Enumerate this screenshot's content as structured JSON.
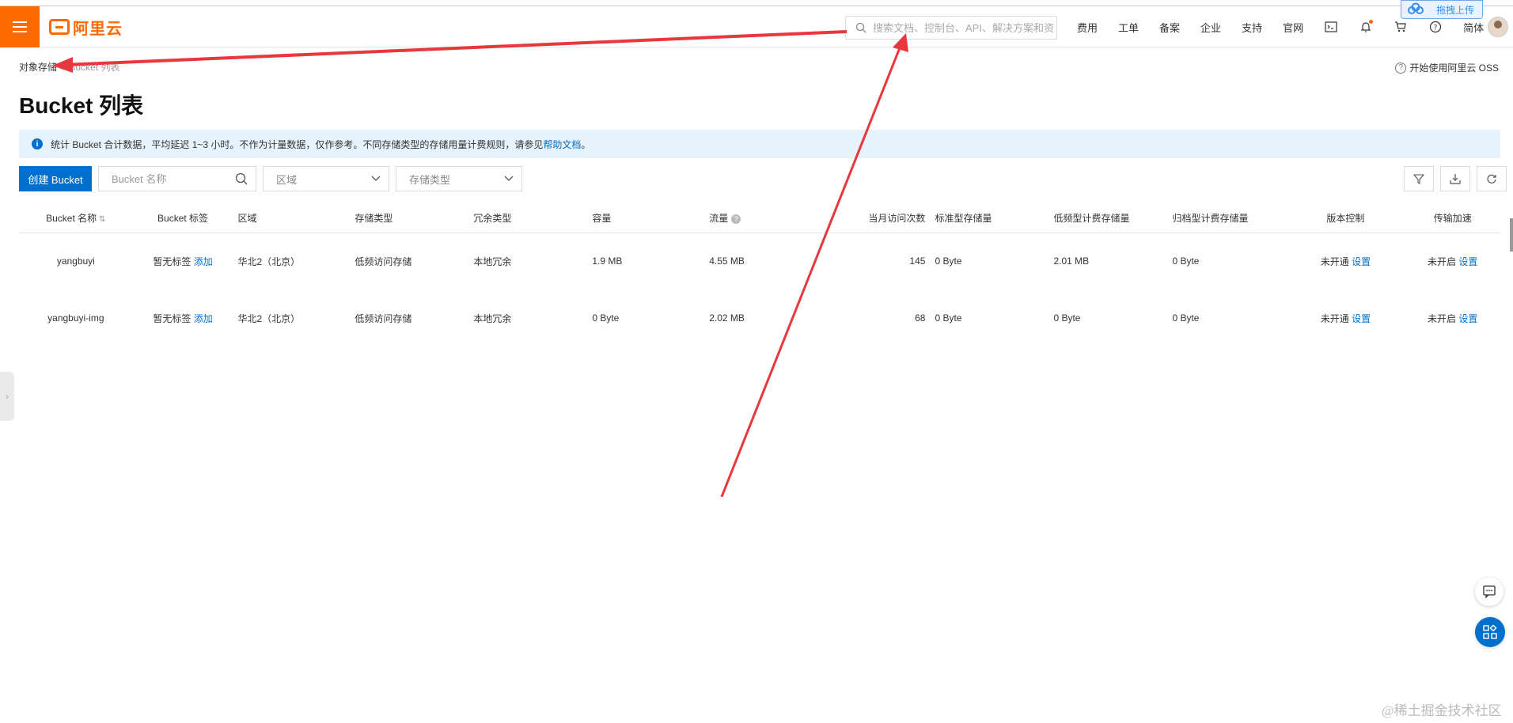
{
  "header": {
    "logo_text": "阿里云",
    "search_placeholder": "搜索文档、控制台、API、解决方案和资源",
    "nav_items": [
      "费用",
      "工单",
      "备案",
      "企业",
      "支持",
      "官网"
    ],
    "language": "简体",
    "upload_tag": "拖拽上传",
    "accent_color": "#ff6a00"
  },
  "breadcrumb": {
    "root": "对象存储",
    "separator": "/",
    "current": "Bucket 列表"
  },
  "help_link": "开始使用阿里云 OSS",
  "page_title": "Bucket 列表",
  "notice": {
    "text": "统计 Bucket 合计数据，平均延迟 1~3 小时。不作为计量数据，仅作参考。不同存储类型的存储用量计费规则，请参见",
    "link": "帮助文档",
    "end": "。"
  },
  "toolbar": {
    "create_label": "创建 Bucket",
    "name_placeholder": "Bucket 名称",
    "region_placeholder": "区域",
    "storage_type_placeholder": "存储类型"
  },
  "table": {
    "columns": [
      "Bucket 名称",
      "Bucket 标签",
      "区域",
      "存储类型",
      "冗余类型",
      "容量",
      "流量",
      "当月访问次数",
      "标准型存储量",
      "低频型计费存储量",
      "归档型计费存储量",
      "版本控制",
      "传输加速"
    ],
    "rows": [
      {
        "name": "yangbuyi",
        "tag": "暂无标签",
        "tag_action": "添加",
        "region": "华北2（北京）",
        "storage": "低频访问存储",
        "redundancy": "本地冗余",
        "capacity": "1.9 MB",
        "traffic": "4.55 MB",
        "visits": "145",
        "standard": "0 Byte",
        "ia": "2.01 MB",
        "archive": "0 Byte",
        "versioning": "未开通",
        "versioning_action": "设置",
        "accel": "未开启",
        "accel_action": "设置"
      },
      {
        "name": "yangbuyi-img",
        "tag": "暂无标签",
        "tag_action": "添加",
        "region": "华北2（北京）",
        "storage": "低频访问存储",
        "redundancy": "本地冗余",
        "capacity": "0 Byte",
        "traffic": "2.02 MB",
        "visits": "68",
        "standard": "0 Byte",
        "ia": "0 Byte",
        "archive": "0 Byte",
        "versioning": "未开通",
        "versioning_action": "设置",
        "accel": "未开启",
        "accel_action": "设置"
      }
    ]
  },
  "watermark": "@稀土掘金技术社区",
  "annotation_color": "#e8383d"
}
